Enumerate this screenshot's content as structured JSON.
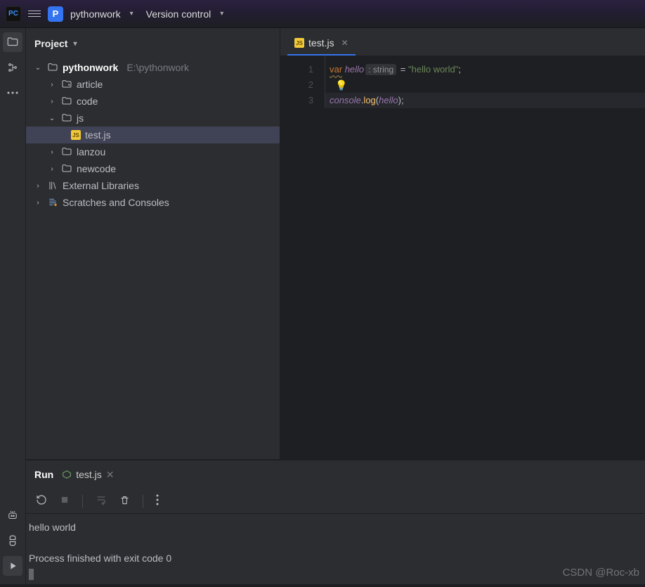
{
  "topbar": {
    "logo_text": "PC",
    "project_badge": "P",
    "project_name": "pythonwork",
    "vc_label": "Version control"
  },
  "project_panel": {
    "title": "Project",
    "root": {
      "name": "pythonwork",
      "path": "E:\\pythonwork"
    },
    "folders": [
      {
        "name": "article"
      },
      {
        "name": "code"
      },
      {
        "name": "js",
        "expanded": true,
        "children": [
          {
            "name": "test.js",
            "selected": true
          }
        ]
      },
      {
        "name": "lanzou"
      },
      {
        "name": "newcode"
      }
    ],
    "external": "External Libraries",
    "scratches": "Scratches and Consoles"
  },
  "editor": {
    "tab_name": "test.js",
    "lines": [
      "1",
      "2",
      "3"
    ],
    "code": {
      "kw_var": "var",
      "var_name": "hello",
      "type_hint": ": string",
      "eq": " = ",
      "str_lit": "\"hello world\"",
      "semi": ";",
      "console": "console",
      "dot": ".",
      "log": "log",
      "open_p": "(",
      "close_p_semi": ");",
      "arg": "hello"
    }
  },
  "run": {
    "tool_label": "Run",
    "conf_name": "test.js",
    "output_line1": "hello world",
    "output_line2": "Process finished with exit code 0"
  },
  "watermark": "CSDN @Roc-xb"
}
